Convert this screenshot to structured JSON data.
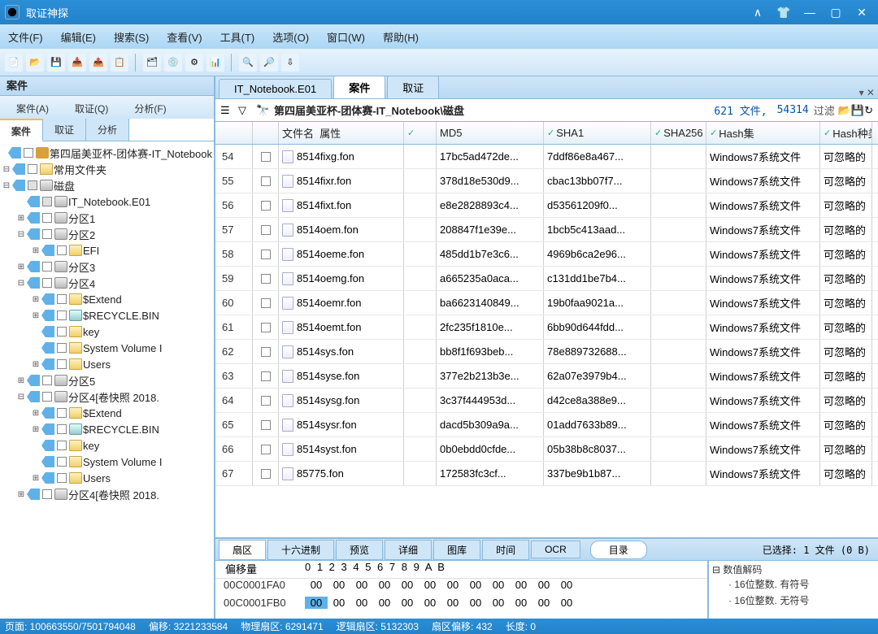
{
  "app": {
    "title": "取证神探"
  },
  "menubar": [
    "文件(F)",
    "编辑(E)",
    "搜索(S)",
    "查看(V)",
    "工具(T)",
    "选项(O)",
    "窗口(W)",
    "帮助(H)"
  ],
  "left": {
    "panel_title": "案件",
    "subtabs1": [
      "案件(A)",
      "取证(Q)",
      "分析(F)"
    ],
    "subtabs2": [
      "案件",
      "取证",
      "分析"
    ],
    "subtabs2_active": 0,
    "tree": [
      {
        "d": 0,
        "e": "",
        "i": "key",
        "t": "第四届美亚杯-团体赛-IT_Notebook"
      },
      {
        "d": 0,
        "e": "-",
        "i": "fold",
        "t": "常用文件夹"
      },
      {
        "d": 0,
        "e": "-",
        "i": "disk",
        "t": "磁盘",
        "half": true
      },
      {
        "d": 1,
        "e": "",
        "i": "disk",
        "t": "IT_Notebook.E01",
        "half": true
      },
      {
        "d": 1,
        "e": "+",
        "i": "disk",
        "t": "分区1"
      },
      {
        "d": 1,
        "e": "-",
        "i": "disk",
        "t": "分区2"
      },
      {
        "d": 2,
        "e": "+",
        "i": "fold",
        "t": "EFI"
      },
      {
        "d": 1,
        "e": "+",
        "i": "disk",
        "t": "分区3"
      },
      {
        "d": 1,
        "e": "-",
        "i": "disk",
        "t": "分区4"
      },
      {
        "d": 2,
        "e": "+",
        "i": "fold",
        "t": "$Extend"
      },
      {
        "d": 2,
        "e": "+",
        "i": "recycle",
        "t": "$RECYCLE.BIN"
      },
      {
        "d": 2,
        "e": "",
        "i": "fold",
        "t": "key"
      },
      {
        "d": 2,
        "e": "",
        "i": "fold",
        "t": "System Volume I"
      },
      {
        "d": 2,
        "e": "+",
        "i": "fold",
        "t": "Users"
      },
      {
        "d": 1,
        "e": "+",
        "i": "disk",
        "t": "分区5"
      },
      {
        "d": 1,
        "e": "-",
        "i": "disk",
        "t": "分区4[卷快照 2018."
      },
      {
        "d": 2,
        "e": "+",
        "i": "fold",
        "t": "$Extend"
      },
      {
        "d": 2,
        "e": "+",
        "i": "recycle",
        "t": "$RECYCLE.BIN"
      },
      {
        "d": 2,
        "e": "",
        "i": "fold",
        "t": "key"
      },
      {
        "d": 2,
        "e": "",
        "i": "fold",
        "t": "System Volume I"
      },
      {
        "d": 2,
        "e": "+",
        "i": "fold",
        "t": "Users"
      },
      {
        "d": 1,
        "e": "+",
        "i": "disk",
        "t": "分区4[卷快照 2018."
      }
    ]
  },
  "right": {
    "tabs": [
      "IT_Notebook.E01",
      "案件",
      "取证"
    ],
    "active_tab": 1,
    "path": "第四届美亚杯-团体赛-IT_Notebook\\磁盘",
    "stats_files": "621 文件,",
    "stats_count": "54314",
    "filter_label": "过滤",
    "columns": {
      "name": "文件名",
      "attr": "属性",
      "md5": "MD5",
      "sha1": "SHA1",
      "sha256": "SHA256",
      "hset": "Hash集",
      "htype": "Hash种类"
    },
    "rows": [
      {
        "idx": 54,
        "name": "8514fixg.fon",
        "md5": "17bc5ad472de...",
        "sha1": "7ddf86e8a467...",
        "hset": "Windows7系统文件",
        "htype": "可忽略的"
      },
      {
        "idx": 55,
        "name": "8514fixr.fon",
        "md5": "378d18e530d9...",
        "sha1": "cbac13bb07f7...",
        "hset": "Windows7系统文件",
        "htype": "可忽略的"
      },
      {
        "idx": 56,
        "name": "8514fixt.fon",
        "md5": "e8e2828893c4...",
        "sha1": "d53561209f0...",
        "hset": "Windows7系统文件",
        "htype": "可忽略的"
      },
      {
        "idx": 57,
        "name": "8514oem.fon",
        "md5": "208847f1e39e...",
        "sha1": "1bcb5c413aad...",
        "hset": "Windows7系统文件",
        "htype": "可忽略的"
      },
      {
        "idx": 58,
        "name": "8514oeme.fon",
        "md5": "485dd1b7e3c6...",
        "sha1": "4969b6ca2e96...",
        "hset": "Windows7系统文件",
        "htype": "可忽略的"
      },
      {
        "idx": 59,
        "name": "8514oemg.fon",
        "md5": "a665235a0aca...",
        "sha1": "c131dd1be7b4...",
        "hset": "Windows7系统文件",
        "htype": "可忽略的"
      },
      {
        "idx": 60,
        "name": "8514oemr.fon",
        "md5": "ba6623140849...",
        "sha1": "19b0faa9021a...",
        "hset": "Windows7系统文件",
        "htype": "可忽略的"
      },
      {
        "idx": 61,
        "name": "8514oemt.fon",
        "md5": "2fc235f1810e...",
        "sha1": "6bb90d644fdd...",
        "hset": "Windows7系统文件",
        "htype": "可忽略的"
      },
      {
        "idx": 62,
        "name": "8514sys.fon",
        "md5": "bb8f1f693beb...",
        "sha1": "78e889732688...",
        "hset": "Windows7系统文件",
        "htype": "可忽略的"
      },
      {
        "idx": 63,
        "name": "8514syse.fon",
        "md5": "377e2b213b3e...",
        "sha1": "62a07e3979b4...",
        "hset": "Windows7系统文件",
        "htype": "可忽略的"
      },
      {
        "idx": 64,
        "name": "8514sysg.fon",
        "md5": "3c37f444953d...",
        "sha1": "d42ce8a388e9...",
        "hset": "Windows7系统文件",
        "htype": "可忽略的"
      },
      {
        "idx": 65,
        "name": "8514sysr.fon",
        "md5": "dacd5b309a9a...",
        "sha1": "01add7633b89...",
        "hset": "Windows7系统文件",
        "htype": "可忽略的"
      },
      {
        "idx": 66,
        "name": "8514syst.fon",
        "md5": "0b0ebdd0cfde...",
        "sha1": "05b38b8c8037...",
        "hset": "Windows7系统文件",
        "htype": "可忽略的"
      },
      {
        "idx": 67,
        "name": "85775.fon",
        "md5": "172583fc3cf...",
        "sha1": "337be9b1b87...",
        "hset": "Windows7系统文件",
        "htype": "可忽略的"
      }
    ],
    "bottom_tabs": [
      "扇区",
      "十六进制",
      "预览",
      "详细",
      "图库",
      "时间",
      "OCR"
    ],
    "bottom_active": 0,
    "dir_btn": "目录",
    "sel_info": "已选择: 1 文件 (0 B)",
    "hex": {
      "offset_label": "偏移量",
      "cols": "0  1  2  3  4  5  6  7   8  9  A  B",
      "rows": [
        {
          "addr": "00C0001FA0",
          "bytes": [
            "00",
            "00",
            "00",
            "00",
            "00",
            "00",
            "00",
            "00",
            "00",
            "00",
            "00",
            "00"
          ],
          "hl": -1
        },
        {
          "addr": "00C0001FB0",
          "bytes": [
            "00",
            "00",
            "00",
            "00",
            "00",
            "00",
            "00",
            "00",
            "00",
            "00",
            "00",
            "00"
          ],
          "hl": 0
        }
      ],
      "decode_title": "⊟ 数值解码",
      "decode_items": [
        "16位整数. 有符号",
        "16位整数. 无符号"
      ]
    }
  },
  "status": {
    "page": "页面: 100663550/7501794048",
    "off": "偏移: 3221233584",
    "phys": "物理扇区: 6291471",
    "log": "逻辑扇区: 5132303",
    "sec": "扇区偏移: 432",
    "len": "长度: 0"
  }
}
